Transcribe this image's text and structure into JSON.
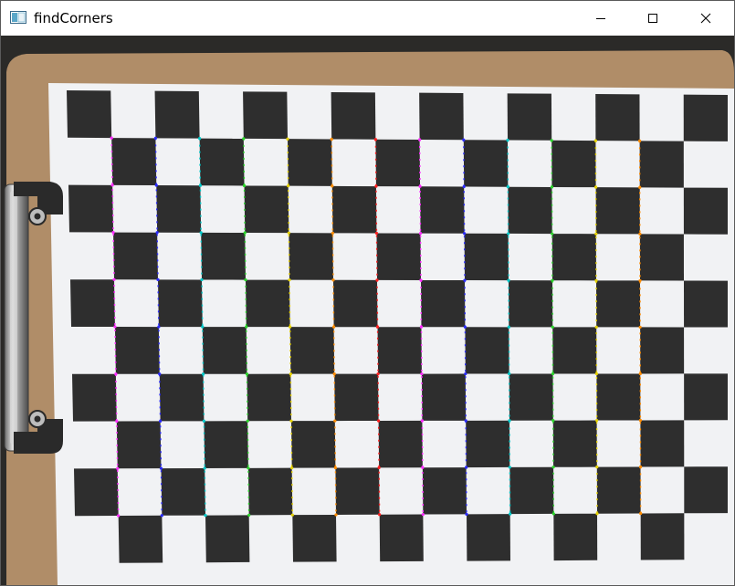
{
  "window": {
    "title": "findCorners",
    "app_icon": "opencv-window-icon",
    "controls": {
      "minimize_icon": "minimize-icon",
      "maximize_icon": "maximize-icon",
      "close_icon": "close-icon"
    }
  },
  "image": {
    "description_kind": "camera-frame",
    "board": {
      "squares_across": 15,
      "squares_down": 10,
      "inner_corners_across": 13,
      "inner_corners_down": 9
    },
    "corner_line_colors": [
      "#ff2bff",
      "#2b2bff",
      "#00c8c8",
      "#2bd62b",
      "#e6d200",
      "#ff8c00",
      "#ff2020",
      "#ff2bff",
      "#2b2bff",
      "#00c8c8",
      "#2bd62b",
      "#e6d200",
      "#ff8c00"
    ]
  }
}
